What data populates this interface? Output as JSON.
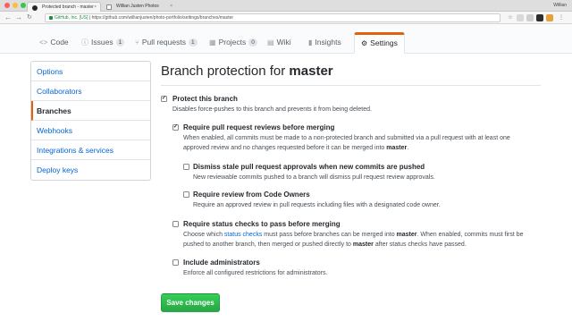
{
  "browser": {
    "tabs": [
      {
        "title": "Protected branch - master",
        "active": true
      },
      {
        "title": "Willian Justen Photos",
        "active": false
      }
    ],
    "user_name": "Willian",
    "address": {
      "secure_label": "GitHub, Inc. [US]",
      "separator": "|",
      "url": "https://github.com/willianjusten/photo-portfolio/settings/branches/master"
    }
  },
  "repo_nav": {
    "tabs": [
      {
        "label": "Code",
        "icon": "code-icon"
      },
      {
        "label": "Issues",
        "icon": "issue-icon",
        "count": "1"
      },
      {
        "label": "Pull requests",
        "icon": "pull-request-icon",
        "count": "1"
      },
      {
        "label": "Projects",
        "icon": "project-icon",
        "count": "0"
      },
      {
        "label": "Wiki",
        "icon": "book-icon"
      },
      {
        "label": "Insights",
        "icon": "graph-icon"
      },
      {
        "label": "Settings",
        "icon": "gear-icon",
        "selected": true
      }
    ]
  },
  "sidebar": {
    "items": [
      {
        "label": "Options"
      },
      {
        "label": "Collaborators"
      },
      {
        "label": "Branches",
        "selected": true
      },
      {
        "label": "Webhooks"
      },
      {
        "label": "Integrations & services"
      },
      {
        "label": "Deploy keys"
      }
    ]
  },
  "main": {
    "title_prefix": "Branch protection for ",
    "branch": "master",
    "options": {
      "protect": {
        "label": "Protect this branch",
        "checked": true,
        "desc": "Disables force-pushes to this branch and prevents it from being deleted."
      },
      "reviews": {
        "label": "Require pull request reviews before merging",
        "checked": true,
        "desc_1": "When enabled, all commits must be made to a non-protected branch and submitted via a pull request with at least one approved review and no changes requested before it can be merged into ",
        "desc_branch": "master",
        "desc_end": "."
      },
      "dismiss": {
        "label": "Dismiss stale pull request approvals when new commits are pushed",
        "checked": false,
        "desc": "New reviewable commits pushed to a branch will dismiss pull request review approvals."
      },
      "owners": {
        "label": "Require review from Code Owners",
        "checked": false,
        "desc": "Require an approved review in pull requests including files with a designated code owner."
      },
      "status": {
        "label": "Require status checks to pass before merging",
        "checked": false,
        "desc_1": "Choose which ",
        "desc_link": "status checks",
        "desc_2": " must pass before branches can be merged into ",
        "desc_branch": "master",
        "desc_3": ". When enabled, commits must first be pushed to another branch, then merged or pushed directly to ",
        "desc_branch_2": "master",
        "desc_4": " after status checks have passed."
      },
      "admins": {
        "label": "Include administrators",
        "checked": false,
        "desc": "Enforce all configured restrictions for administrators."
      }
    },
    "save_label": "Save changes"
  },
  "colors": {
    "accent": "#e36209",
    "link": "#0366d6",
    "primary_button": "#28a745"
  }
}
